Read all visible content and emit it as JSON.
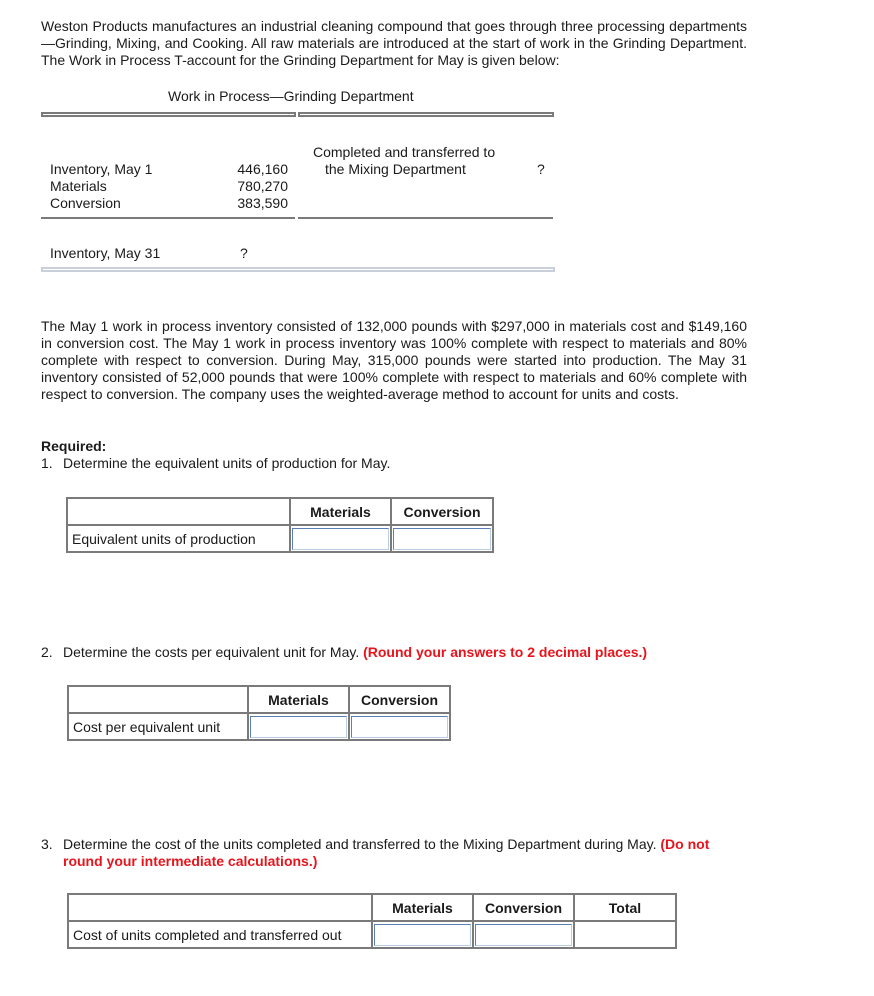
{
  "intro": "Weston Products manufactures an industrial cleaning compound that goes through three processing departments—Grinding, Mixing, and Cooking. All raw materials are introduced at the start of work in the Grinding Department. The Work in Process T-account for the Grinding Department for May is given below:",
  "t_account": {
    "title": "Work in Process—Grinding Department",
    "debits": [
      {
        "label": "Inventory, May 1",
        "value": "446,160"
      },
      {
        "label": "Materials",
        "value": "780,270"
      },
      {
        "label": "Conversion",
        "value": "383,590"
      }
    ],
    "credit": {
      "label_line1": "Completed and transferred to",
      "label_line2": "the Mixing Department",
      "value": "?"
    },
    "ending": {
      "label": "Inventory, May 31",
      "value": "?"
    }
  },
  "details": "The May 1 work in process inventory consisted of 132,000 pounds with $297,000 in materials cost and $149,160 in conversion cost. The May 1 work in process inventory was 100% complete with respect to materials and 80% complete with respect to conversion. During May, 315,000 pounds were started into production. The May 31 inventory consisted of 52,000 pounds that were 100% complete with respect to materials and 60% complete with respect to conversion. The company uses the weighted-average method to account for units and costs.",
  "required_label": "Required:",
  "questions": [
    {
      "number": "1.",
      "text": "Determine the equivalent units of production for May.",
      "note": "",
      "table": {
        "columns": [
          "",
          "Materials",
          "Conversion"
        ],
        "row_label": "Equivalent units of production",
        "values": [
          "",
          ""
        ]
      }
    },
    {
      "number": "2.",
      "text": "Determine the costs per equivalent unit for May.",
      "note": "(Round your answers to 2 decimal places.)",
      "table": {
        "columns": [
          "",
          "Materials",
          "Conversion"
        ],
        "row_label": "Cost per equivalent unit",
        "values": [
          "",
          ""
        ]
      }
    },
    {
      "number": "3.",
      "text": "Determine the cost of the units completed and transferred to the Mixing Department during May.",
      "note_line1": "(Do not",
      "note_line2": "round your intermediate calculations.)",
      "table": {
        "columns": [
          "",
          "Materials",
          "Conversion",
          "Total"
        ],
        "row_label": "Cost of units completed and transferred out",
        "values": [
          "",
          "",
          ""
        ]
      }
    }
  ],
  "colors": {
    "instruction_red": "#e8141c",
    "table_border": "#7a7a7a",
    "input_border": "#7b9cc9"
  }
}
